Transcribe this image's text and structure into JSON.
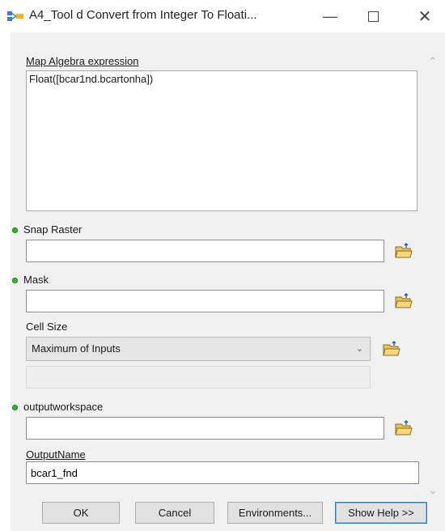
{
  "window": {
    "title": "A4_Tool d Convert from Integer To Floati...",
    "icon": "modelbuilder-tool-icon"
  },
  "form": {
    "map_algebra": {
      "label": "Map Algebra expression",
      "value": "Float([bcar1nd.bcartonha])"
    },
    "snap_raster": {
      "label": "Snap Raster",
      "value": ""
    },
    "mask": {
      "label": "Mask",
      "value": ""
    },
    "cell_size": {
      "label": "Cell Size",
      "selected": "Maximum of Inputs"
    },
    "output_workspace": {
      "label": "outputworkspace",
      "value": ""
    },
    "output_name": {
      "label": "OutputName",
      "value": "bcar1_fnd"
    }
  },
  "buttons": {
    "ok": "OK",
    "cancel": "Cancel",
    "environments": "Environments...",
    "show_help": "Show Help >>"
  },
  "colors": {
    "required_dot": "#2fb52f",
    "folder_icon": "#e8c25a"
  }
}
